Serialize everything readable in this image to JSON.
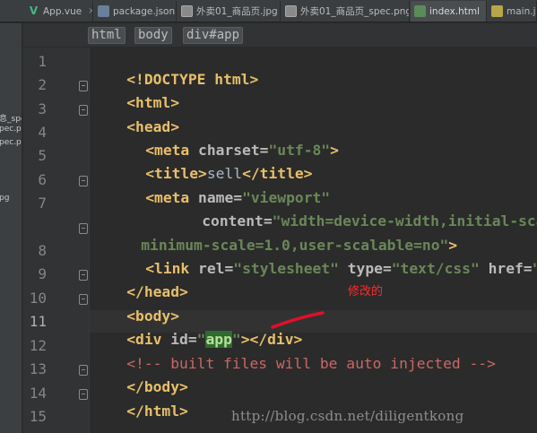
{
  "tabs": [
    {
      "label": "App.vue",
      "icon": "vue-file-icon",
      "active": false
    },
    {
      "label": "package.json",
      "icon": "json-file-icon",
      "active": false
    },
    {
      "label": "外卖01_商品页.jpg",
      "icon": "image-file-icon",
      "active": false
    },
    {
      "label": "外卖01_商品页_spec.png",
      "icon": "image-file-icon",
      "active": false
    },
    {
      "label": "index.html",
      "icon": "html-file-icon",
      "active": true
    },
    {
      "label": "main.js",
      "icon": "js-file-icon",
      "active": false
    }
  ],
  "tab_close_glyph": "×",
  "left_panel": {
    "items": [
      "息_spe",
      "pec.pn",
      "pec.pn",
      "pg"
    ]
  },
  "breadcrumb": [
    "html",
    "body",
    "div#app"
  ],
  "line_numbers": [
    "1",
    "2",
    "3",
    "4",
    "5",
    "6",
    "7",
    "8",
    "9",
    "10",
    "11",
    "12",
    "13",
    "14",
    "15"
  ],
  "code": {
    "l1": {
      "a": "<!DOCTYPE ",
      "b": "html",
      "c": ">"
    },
    "l2": {
      "a": "<html>"
    },
    "l3": {
      "a": "<head>"
    },
    "l4": {
      "a": "<meta ",
      "b": "charset",
      "c": "=",
      "d": "\"utf-8\"",
      "e": ">"
    },
    "l5": {
      "a": "<title>",
      "b": "sell",
      "c": "</title>"
    },
    "l6": {
      "a": "<meta ",
      "b": "name",
      "c": "=",
      "d": "\"viewport\""
    },
    "l7": {
      "a": "content",
      "b": "=",
      "c": "\"width=device-width,initial-scal"
    },
    "l7b": {
      "a": "minimum-scale=1.0,user-scalable=no\"",
      "b": ">"
    },
    "l8": {
      "a": "<link ",
      "b": "rel",
      "c": "=",
      "d": "\"stylesheet\"",
      "e": " type",
      "f": "=",
      "g": "\"text/css\"",
      "h": " href",
      "i": "=",
      "j": "\"s"
    },
    "l9": {
      "a": "</head>"
    },
    "l10": {
      "a": "<body>"
    },
    "l11": {
      "a": "<div ",
      "b": "id",
      "c": "=",
      "d": "\"",
      "e": "app",
      "f": "\"",
      "g": "></div>"
    },
    "l12": {
      "a": "<!-- built files will be auto injected -->"
    },
    "l13": {
      "a": "</body>"
    },
    "l14": {
      "a": "</html>"
    }
  },
  "annotation": {
    "label": "修改的",
    "color": "#e0102a"
  },
  "watermark": "http://blog.csdn.net/diligentkong",
  "colors": {
    "background": "#2b2b2b",
    "tag": "#e8bf6a",
    "string": "#6a8759",
    "comment": "#cc6666",
    "line_number": "#858585"
  }
}
